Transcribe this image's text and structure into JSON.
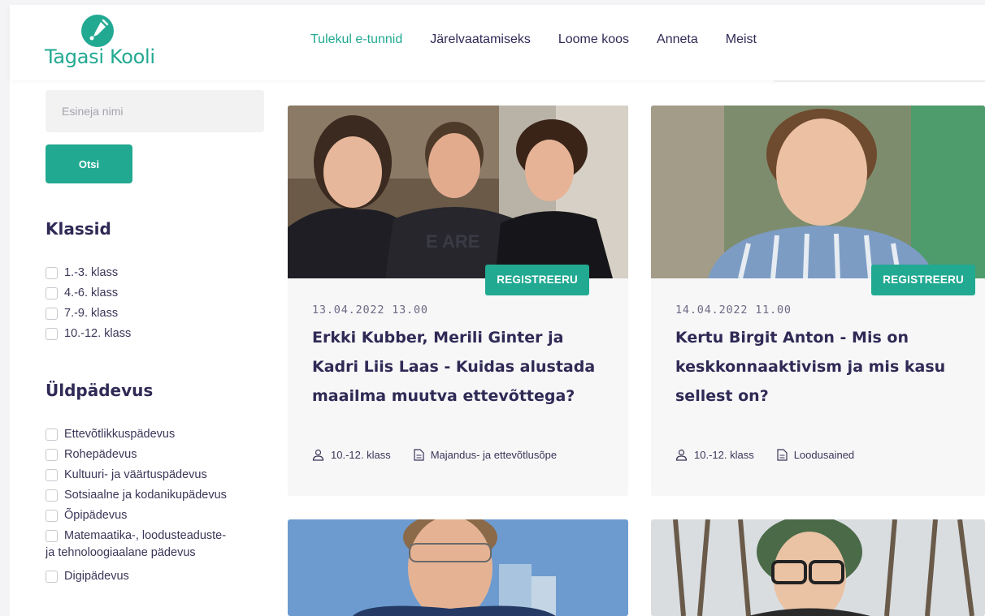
{
  "brand": {
    "name": "Tagasi Kooli"
  },
  "nav": [
    {
      "label": "Tulekul e-tunnid",
      "active": true
    },
    {
      "label": "Järelvaatamiseks",
      "active": false
    },
    {
      "label": "Loome koos",
      "active": false
    },
    {
      "label": "Anneta",
      "active": false
    },
    {
      "label": "Meist",
      "active": false
    }
  ],
  "search": {
    "placeholder": "Esineja nimi",
    "value": "",
    "button_label": "Otsi"
  },
  "filters": {
    "classes": {
      "title": "Klassid",
      "items": [
        "1.-3. klass",
        "4.-6. klass",
        "7.-9. klass",
        "10.-12. klass"
      ]
    },
    "competences": {
      "title": "Üldpädevus",
      "items": [
        "Ettevõtlikkuspädevus",
        "Rohepädevus",
        "Kultuuri- ja väärtuspädevus",
        "Sotsiaalne ja kodanikupädevus",
        "Õpipädevus",
        "Matemaatika-, loodusteaduste-",
        "Digipädevus"
      ],
      "wrapped_line": "ja tehnoloogiaalane pädevus"
    }
  },
  "cards": [
    {
      "badge": "REGISTREERU",
      "date": "13.04.2022 13.00",
      "title": "Erkki Kubber, Merili Ginter ja Kadri Liis Laas - Kuidas alustada maailma muutva ettevõttega?",
      "class": "10.-12. klass",
      "subject": "Majandus- ja ettevõtlusõpe"
    },
    {
      "badge": "REGISTREERU",
      "date": "14.04.2022 11.00",
      "title": "Kertu Birgit Anton - Mis on keskkonnaaktivism ja mis kasu sellest on?",
      "class": "10.-12. klass",
      "subject": "Loodusained"
    }
  ],
  "colors": {
    "accent": "#22a992",
    "text": "#2f2a55",
    "card_bg": "#f7f7f8"
  }
}
